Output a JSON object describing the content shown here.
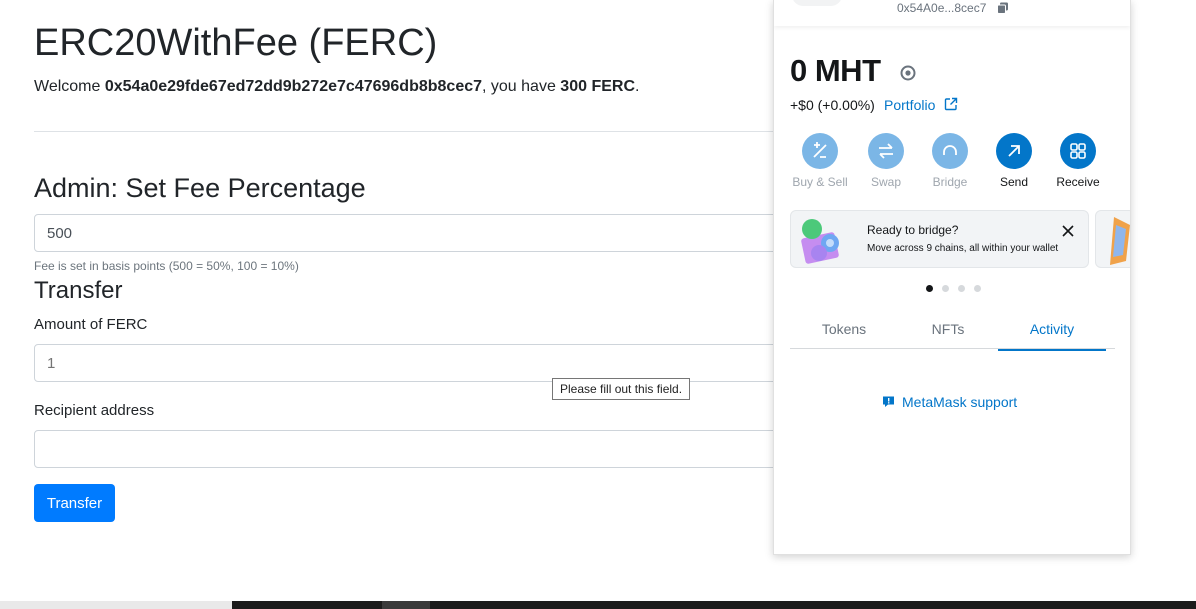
{
  "app": {
    "title": "ERC20WithFee (FERC)",
    "welcome_prefix": "Welcome ",
    "address": "0x54a0e29fde67ed72dd9b272e7c47696db8b8cec7",
    "welcome_middle": ", you have ",
    "balance": "300 FERC",
    "welcome_suffix": "."
  },
  "admin": {
    "heading": "Admin: Set Fee Percentage",
    "fee_value": "500",
    "help": "Fee is set in basis points (500 = 50%, 100 = 10%)"
  },
  "transfer": {
    "heading": "Transfer",
    "amount_label": "Amount of FERC",
    "amount_placeholder": "1",
    "recipient_label": "Recipient address",
    "recipient_placeholder": "",
    "button_label": "Transfer",
    "validation_tooltip": "Please fill out this field."
  },
  "metamask": {
    "short_address": "0x54A0e...8cec7",
    "balance": "0 MHT",
    "change": "+$0 (+0.00%)",
    "portfolio_label": "Portfolio",
    "actions": [
      {
        "label": "Buy & Sell",
        "icon": "buy-sell-icon",
        "enabled": false
      },
      {
        "label": "Swap",
        "icon": "swap-icon",
        "enabled": false
      },
      {
        "label": "Bridge",
        "icon": "bridge-icon",
        "enabled": false
      },
      {
        "label": "Send",
        "icon": "send-icon",
        "enabled": true
      },
      {
        "label": "Receive",
        "icon": "receive-icon",
        "enabled": true
      }
    ],
    "card": {
      "title": "Ready to bridge?",
      "text": "Move across 9 chains, all within your wallet"
    },
    "carousel_active_index": 0,
    "carousel_count": 4,
    "tabs": [
      {
        "label": "Tokens",
        "active": false
      },
      {
        "label": "NFTs",
        "active": false
      },
      {
        "label": "Activity",
        "active": true
      }
    ],
    "support_label": "MetaMask support",
    "colors": {
      "accent": "#0376c9",
      "disabled_action": "#7bb6e6"
    }
  },
  "colors": {
    "primary_button": "#007bff",
    "text": "#212529",
    "muted": "#6c757d"
  }
}
